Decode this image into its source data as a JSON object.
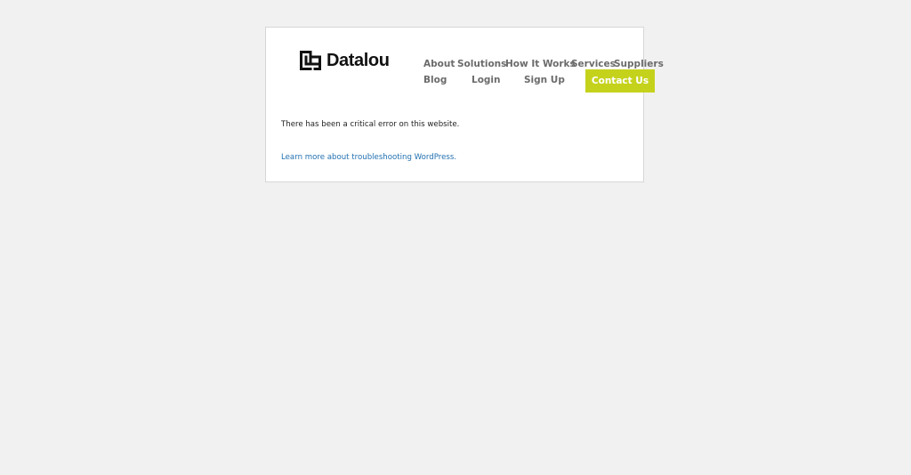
{
  "brand": {
    "name": "Datalou",
    "logo_icon": "datalou-logo-icon"
  },
  "nav": {
    "items": [
      {
        "label": "About"
      },
      {
        "label": "Solutions"
      },
      {
        "label": "How It Works"
      },
      {
        "label": "Services"
      },
      {
        "label": "Suppliers"
      },
      {
        "label": "Blog"
      },
      {
        "label": "Login"
      },
      {
        "label": "Sign Up"
      }
    ],
    "cta_label": "Contact Us"
  },
  "error": {
    "message": "There has been a critical error on this website.",
    "help_link": "Learn more about troubleshooting WordPress."
  },
  "colors": {
    "page_background": "#f1f1f1",
    "cta_background": "#c5d21c",
    "link": "#2271b1",
    "nav_text": "#6b6b6b"
  }
}
